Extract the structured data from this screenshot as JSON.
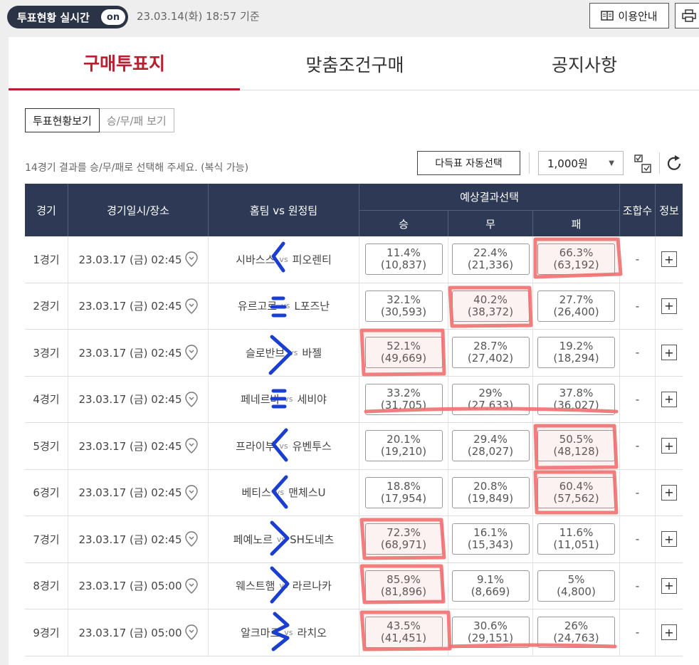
{
  "topbar": {
    "realtime_label": "투표현황 실시간",
    "toggle_label": "on",
    "timestamp": "23.03.14(화) 18:57 기준",
    "guide_label": "이용안내"
  },
  "tabs": [
    {
      "label": "구매투표지",
      "active": true
    },
    {
      "label": "맞춤조건구매",
      "active": false
    },
    {
      "label": "공지사항",
      "active": false
    }
  ],
  "view_toggle": {
    "vote_status": "투표현황보기",
    "wdl": "승/무/패 보기"
  },
  "instruction": "14경기 결과를 승/무/패로 선택해 주세요. (복식 가능)",
  "auto_select_label": "다득표 자동선택",
  "amount": {
    "value": "1,000원"
  },
  "table": {
    "headers": {
      "game": "경기",
      "datetime": "경기일시/장소",
      "teams": "홈팀 vs 원정팀",
      "prediction": "예상결과선택",
      "win": "승",
      "draw": "무",
      "lose": "패",
      "combos": "조합수",
      "info": "정보"
    },
    "rows": [
      {
        "game": "1경기",
        "date": "23.03.17 (금) 02:45",
        "home": "시바스스",
        "away": "피오렌티",
        "vs": "vs",
        "win_pct": "11.4%",
        "win_cnt": "(10,837)",
        "draw_pct": "22.4%",
        "draw_cnt": "(21,336)",
        "lose_pct": "66.3%",
        "lose_cnt": "(63,192)",
        "combos": "-",
        "info": "+"
      },
      {
        "game": "2경기",
        "date": "23.03.17 (금) 02:45",
        "home": "유르고르",
        "away": "L포즈난",
        "vs": "vs",
        "win_pct": "32.1%",
        "win_cnt": "(30,593)",
        "draw_pct": "40.2%",
        "draw_cnt": "(38,372)",
        "lose_pct": "27.7%",
        "lose_cnt": "(26,400)",
        "combos": "-",
        "info": "+"
      },
      {
        "game": "3경기",
        "date": "23.03.17 (금) 02:45",
        "home": "슬로반브",
        "away": "바젤",
        "vs": "vs",
        "win_pct": "52.1%",
        "win_cnt": "(49,669)",
        "draw_pct": "28.7%",
        "draw_cnt": "(27,402)",
        "lose_pct": "19.2%",
        "lose_cnt": "(18,294)",
        "combos": "-",
        "info": "+"
      },
      {
        "game": "4경기",
        "date": "23.03.17 (금) 02:45",
        "home": "페네르바",
        "away": "세비야",
        "vs": "vs",
        "win_pct": "33.2%",
        "win_cnt": "(31,705)",
        "draw_pct": "29%",
        "draw_cnt": "(27,633)",
        "lose_pct": "37.8%",
        "lose_cnt": "(36,027)",
        "combos": "-",
        "info": "+"
      },
      {
        "game": "5경기",
        "date": "23.03.17 (금) 02:45",
        "home": "프라이부",
        "away": "유벤투스",
        "vs": "vs",
        "win_pct": "20.1%",
        "win_cnt": "(19,210)",
        "draw_pct": "29.4%",
        "draw_cnt": "(28,027)",
        "lose_pct": "50.5%",
        "lose_cnt": "(48,128)",
        "combos": "-",
        "info": "+"
      },
      {
        "game": "6경기",
        "date": "23.03.17 (금) 02:45",
        "home": "베티스",
        "away": "맨체스U",
        "vs": "vs",
        "win_pct": "18.8%",
        "win_cnt": "(17,954)",
        "draw_pct": "20.8%",
        "draw_cnt": "(19,849)",
        "lose_pct": "60.4%",
        "lose_cnt": "(57,562)",
        "combos": "-",
        "info": "+"
      },
      {
        "game": "7경기",
        "date": "23.03.17 (금) 02:45",
        "home": "페예노르",
        "away": "SH도네츠",
        "vs": "vs",
        "win_pct": "72.3%",
        "win_cnt": "(68,971)",
        "draw_pct": "16.1%",
        "draw_cnt": "(15,343)",
        "lose_pct": "11.6%",
        "lose_cnt": "(11,051)",
        "combos": "-",
        "info": "+"
      },
      {
        "game": "8경기",
        "date": "23.03.17 (금) 05:00",
        "home": "웨스트햄",
        "away": "라르나카",
        "vs": "vs",
        "win_pct": "85.9%",
        "win_cnt": "(81,896)",
        "draw_pct": "9.1%",
        "draw_cnt": "(8,669)",
        "lose_pct": "5%",
        "lose_cnt": "(4,800)",
        "combos": "-",
        "info": "+"
      },
      {
        "game": "9경기",
        "date": "23.03.17 (금) 05:00",
        "home": "알크마르",
        "away": "라치오",
        "vs": "vs",
        "win_pct": "43.5%",
        "win_cnt": "(41,451)",
        "draw_pct": "30.6%",
        "draw_cnt": "(29,151)",
        "lose_pct": "26%",
        "lose_cnt": "(24,763)",
        "combos": "-",
        "info": "+"
      }
    ]
  },
  "colors": {
    "accent": "#b8202f",
    "header_bg": "#2e3a55",
    "highlight": "#f07070",
    "pen": "#1a3fd0"
  }
}
